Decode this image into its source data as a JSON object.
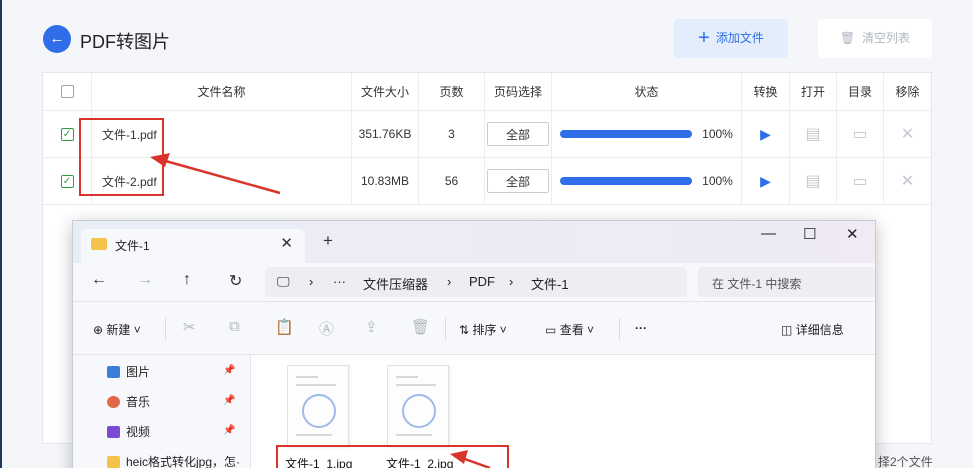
{
  "header": {
    "title": "PDF转图片",
    "add_label": "添加文件",
    "clear_label": "清空列表"
  },
  "table": {
    "columns": [
      "文件名称",
      "文件大小",
      "页数",
      "页码选择",
      "状态",
      "转换",
      "打开",
      "目录",
      "移除"
    ],
    "rows": [
      {
        "name": "文件-1.pdf",
        "size": "351.76KB",
        "pages": "3",
        "range": "全部",
        "progress": 100,
        "percent": "100%"
      },
      {
        "name": "文件-2.pdf",
        "size": "10.83MB",
        "pages": "56",
        "range": "全部",
        "progress": 100,
        "percent": "100%"
      }
    ]
  },
  "explorer": {
    "tab_title": "文件-1",
    "breadcrumb": [
      "文件压缩器",
      "PDF",
      "文件-1"
    ],
    "search_placeholder": "在 文件-1 中搜索",
    "toolbar": {
      "new": "新建",
      "sort": "排序",
      "view": "查看",
      "more": "···",
      "details": "详细信息"
    },
    "sidebar": [
      "图片",
      "音乐",
      "视频",
      "heic格式转化jpg，怎·"
    ],
    "files": [
      "文件-1_1.jpg",
      "文件-1_2.jpg"
    ]
  },
  "status_fragment": "择2个文件",
  "colors": {
    "accent": "#2f6ee8",
    "highlight": "#d9342b",
    "check": "#2f9d46"
  }
}
